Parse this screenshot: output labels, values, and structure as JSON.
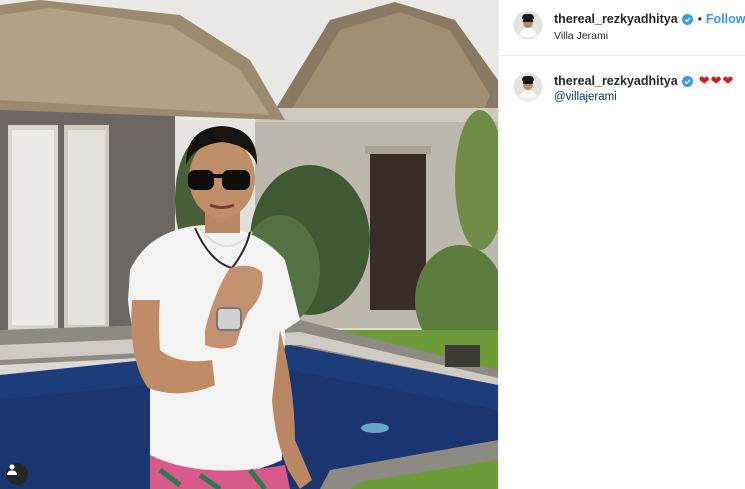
{
  "post": {
    "photo_alt": "",
    "header": {
      "username": "thereal_rezkyadhitya",
      "separator": "•",
      "follow_label": "Follow",
      "location": "Villa Jerami"
    },
    "caption": {
      "username": "thereal_rezkyadhitya",
      "emoji": "❤❤❤",
      "mention": "@villajerami"
    }
  },
  "icons": {
    "verified": "verified-badge-icon",
    "user_tag": "user-tag-icon"
  },
  "colors": {
    "follow": "#3897f0",
    "verified": "#3897f0",
    "mention": "#003569",
    "hearts": "#d31a1a",
    "text": "#262626"
  }
}
